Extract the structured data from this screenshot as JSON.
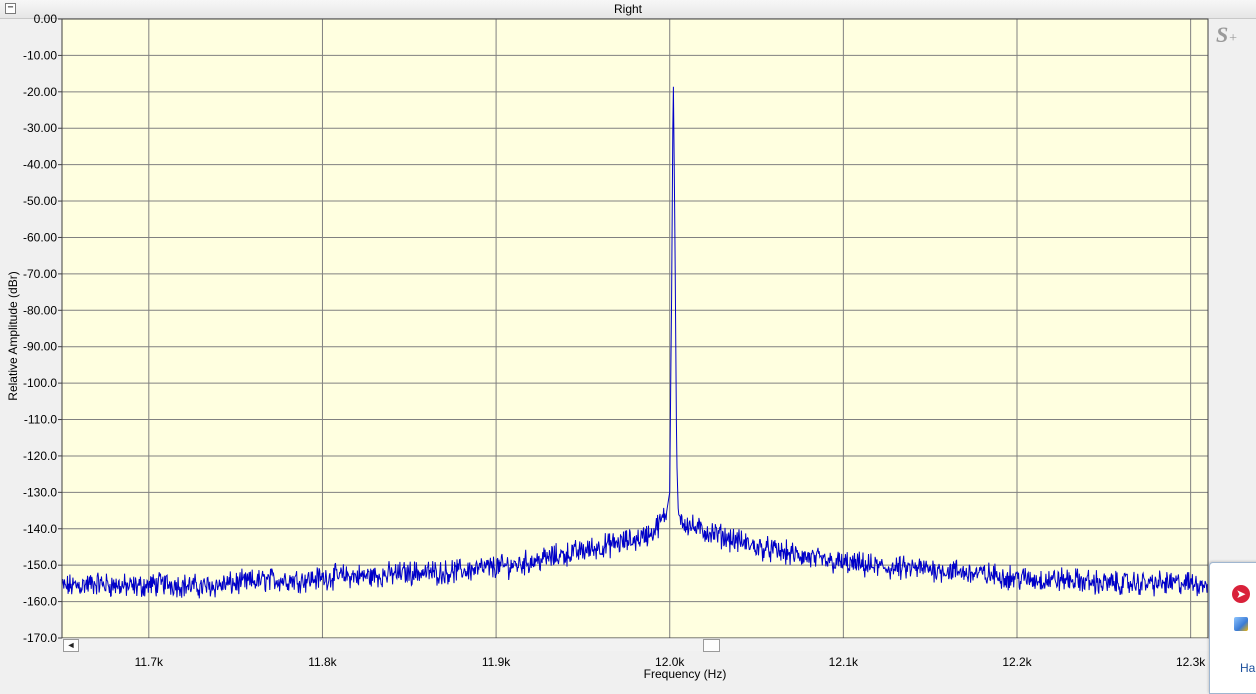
{
  "window": {
    "title": "Right",
    "collapse_glyph": "−"
  },
  "watermark": {
    "text": "S",
    "sup": "+"
  },
  "side_panel": {
    "text": "Ha"
  },
  "colors": {
    "plot_background": "#ffffe0",
    "grid": "#808080",
    "trace": "#0000c8",
    "side_panel_icon": "#d9213a"
  },
  "chart_data": {
    "type": "line",
    "title": "Right",
    "xlabel": "Frequency (Hz)",
    "ylabel": "Relative Amplitude (dBr)",
    "xlim": [
      11650,
      12310
    ],
    "ylim": [
      -170,
      0
    ],
    "x_ticks": [
      {
        "value": 11700,
        "label": "11.7k"
      },
      {
        "value": 11800,
        "label": "11.8k"
      },
      {
        "value": 11900,
        "label": "11.9k"
      },
      {
        "value": 12000,
        "label": "12.0k"
      },
      {
        "value": 12100,
        "label": "12.1k"
      },
      {
        "value": 12200,
        "label": "12.2k"
      },
      {
        "value": 12300,
        "label": "12.3k"
      }
    ],
    "y_ticks": [
      {
        "value": 0,
        "label": "0.00"
      },
      {
        "value": -10,
        "label": "-10.00"
      },
      {
        "value": -20,
        "label": "-20.00"
      },
      {
        "value": -30,
        "label": "-30.00"
      },
      {
        "value": -40,
        "label": "-40.00"
      },
      {
        "value": -50,
        "label": "-50.00"
      },
      {
        "value": -60,
        "label": "-60.00"
      },
      {
        "value": -70,
        "label": "-70.00"
      },
      {
        "value": -80,
        "label": "-80.00"
      },
      {
        "value": -90,
        "label": "-90.00"
      },
      {
        "value": -100,
        "label": "-100.0"
      },
      {
        "value": -110,
        "label": "-110.0"
      },
      {
        "value": -120,
        "label": "-120.0"
      },
      {
        "value": -130,
        "label": "-130.0"
      },
      {
        "value": -140,
        "label": "-140.0"
      },
      {
        "value": -150,
        "label": "-150.0"
      },
      {
        "value": -160,
        "label": "-160.0"
      },
      {
        "value": -170,
        "label": "-170.0"
      }
    ],
    "grid": true,
    "series": [
      {
        "color": "#0000c8",
        "points": [
          [
            11650,
            -156
          ],
          [
            11670,
            -155
          ],
          [
            11690,
            -156
          ],
          [
            11710,
            -155
          ],
          [
            11730,
            -156
          ],
          [
            11750,
            -155
          ],
          [
            11770,
            -154
          ],
          [
            11790,
            -154
          ],
          [
            11810,
            -153
          ],
          [
            11830,
            -153
          ],
          [
            11850,
            -152
          ],
          [
            11870,
            -152
          ],
          [
            11890,
            -151
          ],
          [
            11910,
            -150
          ],
          [
            11930,
            -148
          ],
          [
            11950,
            -146
          ],
          [
            11960,
            -145
          ],
          [
            11970,
            -144
          ],
          [
            11980,
            -143
          ],
          [
            11990,
            -141
          ],
          [
            11995,
            -138
          ],
          [
            11998,
            -136
          ],
          [
            12000,
            -130
          ],
          [
            12001,
            -80
          ],
          [
            12002,
            -14
          ],
          [
            12003,
            -60
          ],
          [
            12004,
            -120
          ],
          [
            12005,
            -136
          ],
          [
            12008,
            -138
          ],
          [
            12015,
            -140
          ],
          [
            12030,
            -142
          ],
          [
            12050,
            -145
          ],
          [
            12070,
            -147
          ],
          [
            12090,
            -149
          ],
          [
            12110,
            -150
          ],
          [
            12130,
            -151
          ],
          [
            12150,
            -151
          ],
          [
            12170,
            -152
          ],
          [
            12190,
            -153
          ],
          [
            12210,
            -154
          ],
          [
            12230,
            -154
          ],
          [
            12250,
            -155
          ],
          [
            12270,
            -155
          ],
          [
            12290,
            -155
          ],
          [
            12310,
            -155
          ]
        ]
      }
    ]
  }
}
